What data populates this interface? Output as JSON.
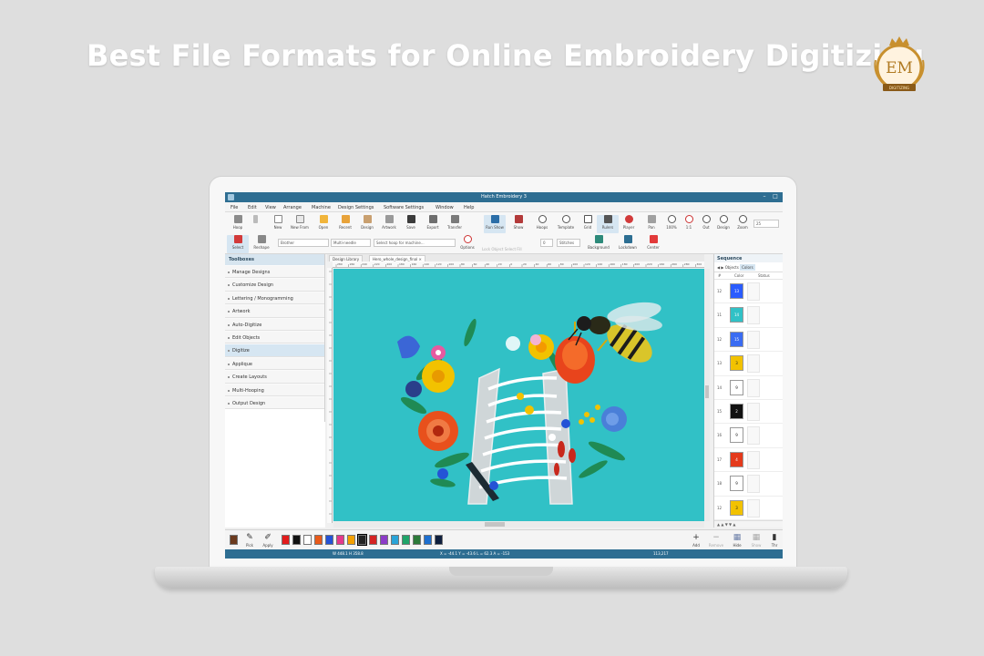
{
  "headline": "Best File Formats for Online Embroidery Digitizing",
  "logo": {
    "letters": "EM",
    "ribbon": "DIGITIZING",
    "gold": "#c8902e"
  },
  "app": {
    "title": "Hatch Embroidery 3",
    "window_buttons": {
      "minimize": "–",
      "maximize": "□"
    },
    "menu": [
      "File",
      "Edit",
      "View",
      "Arrange",
      "Machine",
      "Design Settings",
      "Software Settings",
      "Window",
      "Help"
    ],
    "toolbar1": [
      "Hoop",
      "",
      "New",
      "New From",
      "Open",
      "Recent",
      "Design",
      "Artwork",
      "Save",
      "Export",
      "Transfer",
      "",
      "Run Show",
      "Show",
      "Hoops",
      "Template",
      "Grid",
      "Rulers",
      "Player",
      "",
      "Pan",
      "100%",
      "1:1",
      "Out",
      "Design",
      "Zoom"
    ],
    "zoom_value": "25",
    "toolbar2": {
      "select": "Select",
      "reshape": "Reshape",
      "fabric": "Brother",
      "needle": "Multi-needle",
      "hoop": "Select hoop for machine...",
      "options": "Options",
      "greyed": "Lock Object  Select Fill",
      "zero": "0",
      "units": "Stitches",
      "background": "Background",
      "lockdown": "Lockdown",
      "center": "Center"
    },
    "sidebar": {
      "title": "Toolboxes",
      "items": [
        "Manage Designs",
        "Customize Design",
        "Lettering / Monogramming",
        "Artwork",
        "Auto-Digitize",
        "Edit Objects",
        "Digitize",
        "Applique",
        "Create Layouts",
        "Multi-Hooping",
        "Output Design"
      ],
      "selected_index": 6
    },
    "doc_tabs": [
      "Design Library",
      "Hero_whole_design_final"
    ],
    "ruler_numbers": [
      "280",
      "260",
      "240",
      "220",
      "200",
      "180",
      "160",
      "140",
      "120",
      "100",
      "80",
      "60",
      "40",
      "20",
      "0",
      "20",
      "40",
      "60",
      "80",
      "100",
      "120",
      "140",
      "160",
      "180",
      "200",
      "220",
      "240",
      "260",
      "280",
      "300"
    ],
    "canvas_color": "#31c1c6",
    "sequence": {
      "title": "Sequence",
      "tabs": [
        "Objects",
        "Colors"
      ],
      "active_tab": "Colors",
      "columns": [
        "#",
        "Color",
        "Status"
      ],
      "rows": [
        {
          "num": "12",
          "label": "13",
          "color": "#2a5cff"
        },
        {
          "num": "11",
          "label": "14",
          "color": "#31c1c6"
        },
        {
          "num": "12",
          "label": "15",
          "color": "#3a6cf2"
        },
        {
          "num": "13",
          "label": "3",
          "color": "#f2c200"
        },
        {
          "num": "14",
          "label": "9",
          "color": "#ffffff"
        },
        {
          "num": "15",
          "label": "2",
          "color": "#111111"
        },
        {
          "num": "16",
          "label": "9",
          "color": "#ffffff"
        },
        {
          "num": "17",
          "label": "4",
          "color": "#e43a1c"
        },
        {
          "num": "18",
          "label": "9",
          "color": "#ffffff"
        },
        {
          "num": "12",
          "label": "3",
          "color": "#f2c200"
        }
      ],
      "bottom": "▲ ▲ ▼ ▼ ▲"
    },
    "palette": {
      "pick": "Pick",
      "apply": "Apply",
      "colors": [
        "#e21c1c",
        "#111111",
        "#ffffff",
        "#e85a1a",
        "#2453d6",
        "#e43a8c",
        "#f4a000",
        "#222222",
        "#d42323",
        "#8c3cc8",
        "#2aa4d8",
        "#1fa46a",
        "#2c7a3a",
        "#1d6fd0",
        "#0f1f3d"
      ],
      "add": "Add",
      "remove": "Remove",
      "hide": "Hide",
      "show": "Show",
      "more": "Thr"
    },
    "status": {
      "dimensions": "W 448.1 H 358.8",
      "coords": "X = -44.1 Y = -43.6 L = 62.3 A = -153",
      "stitches": "113,217"
    }
  }
}
